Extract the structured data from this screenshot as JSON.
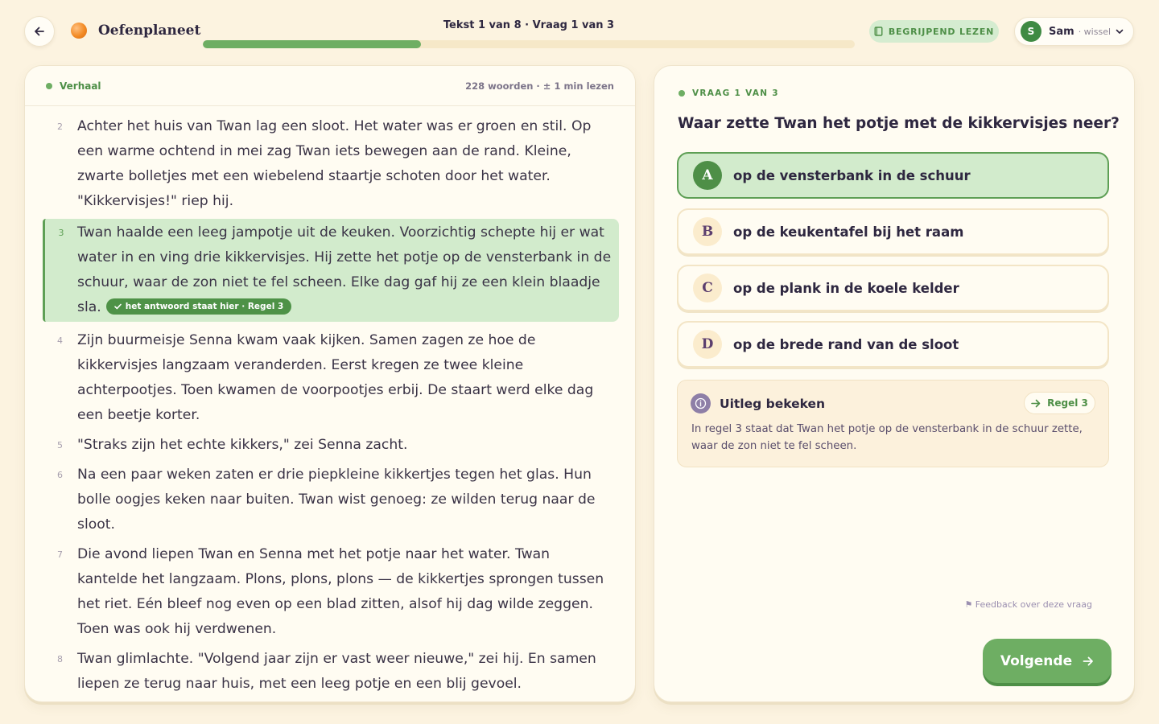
{
  "app": {
    "name": "Oefenplaneet"
  },
  "progress": {
    "label": "Tekst 1 van 8 · Vraag 1 van 3",
    "fraction": 0.335
  },
  "mode": {
    "label": "BEGRIJPEND LEZEN"
  },
  "user": {
    "initial": "S",
    "name": "Sam",
    "switch_label": "· wissel"
  },
  "text_panel": {
    "genre": "Verhaal",
    "meta": "228 woorden · ± 1 min lezen",
    "paragraphs": [
      {
        "num": "2",
        "text": "Achter het huis van Twan lag een sloot. Het water was er groen en stil. Op een warme ochtend in mei zag Twan iets bewegen aan de rand. Kleine, zwarte bolletjes met een wiebelend staartje schoten door het water. \"Kikkervisjes!\" riep hij."
      },
      {
        "num": "3",
        "text": "Twan haalde een leeg jampotje uit de keuken. Voorzichtig schepte hij er wat water in en ving drie kikkervisjes. Hij zette het potje op de vensterbank in de schuur, waar de zon niet te fel scheen. Elke dag gaf hij ze een klein blaadje sla.",
        "highlighted": true,
        "tag": "het antwoord staat hier · Regel 3"
      },
      {
        "num": "4",
        "text": "Zijn buurmeisje Senna kwam vaak kijken. Samen zagen ze hoe de kikkervisjes langzaam veranderden. Eerst kregen ze twee kleine achterpootjes. Toen kwamen de voorpootjes erbij. De staart werd elke dag een beetje korter."
      },
      {
        "num": "5",
        "text": "\"Straks zijn het echte kikkers,\" zei Senna zacht."
      },
      {
        "num": "6",
        "text": "Na een paar weken zaten er drie piepkleine kikkertjes tegen het glas. Hun bolle oogjes keken naar buiten. Twan wist genoeg: ze wilden terug naar de sloot."
      },
      {
        "num": "7",
        "text": "Die avond liepen Twan en Senna met het potje naar het water. Twan kantelde het langzaam. Plons, plons, plons — de kikkertjes sprongen tussen het riet. Eén bleef nog even op een blad zitten, alsof hij dag wilde zeggen. Toen was ook hij verdwenen."
      },
      {
        "num": "8",
        "text": "Twan glimlachte. \"Volgend jaar zijn er vast weer nieuwe,\" zei hij. En samen liepen ze terug naar huis, met een leeg potje en een blij gevoel."
      }
    ]
  },
  "question": {
    "label": "VRAAG 1 VAN 3",
    "text": "Waar zette Twan het potje met de kikkervisjes neer?",
    "options": [
      {
        "letter": "A",
        "text": "op de vensterbank in de schuur",
        "selected": true
      },
      {
        "letter": "B",
        "text": "op de keukentafel bij het raam"
      },
      {
        "letter": "C",
        "text": "op de plank in de koele kelder"
      },
      {
        "letter": "D",
        "text": "op de brede rand van de sloot"
      }
    ]
  },
  "explanation": {
    "title": "Uitleg bekeken",
    "line_ref": "Regel 3",
    "body": "In regel 3 staat dat Twan het potje op de vensterbank in de schuur zette, waar de zon niet te fel scheen."
  },
  "feedback_label": "⚑ Feedback over deze vraag",
  "next_label": "Volgende",
  "icons": {
    "back": "arrow-left-icon",
    "logo": "planet-logo-icon",
    "mode": "book-icon",
    "user_menu": "chevron-down-icon",
    "check": "check-icon",
    "info": "info-icon",
    "line_ref": "arrow-right-icon",
    "next": "arrow-right-icon"
  },
  "colors": {
    "background": "#fcf3e0",
    "accent_green": "#6eae63",
    "dark_green": "#4e8f47",
    "highlight_green": "#d2ebcc",
    "letter_chip": "#fbeccd",
    "explanation_bg": "#fcf1dc",
    "info_purple": "#8e7fa7"
  }
}
